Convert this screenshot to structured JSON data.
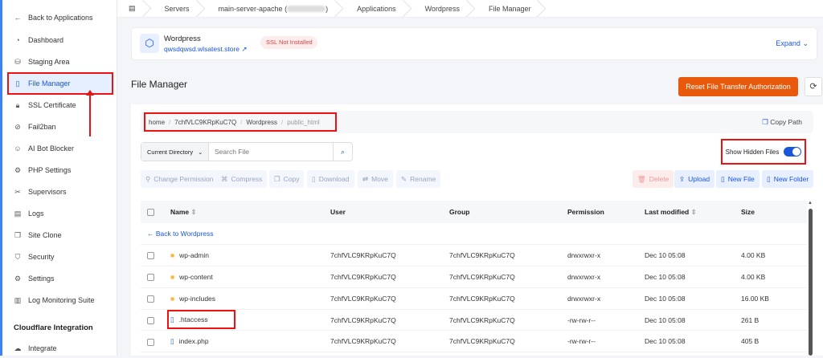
{
  "sidebar": {
    "back": "Back to Applications",
    "items": [
      {
        "label": "Dashboard",
        "icon": "gauge-icon"
      },
      {
        "label": "Staging Area",
        "icon": "database-icon"
      },
      {
        "label": "File Manager",
        "icon": "file-icon"
      },
      {
        "label": "SSL Certificate",
        "icon": "lock-icon"
      },
      {
        "label": "Fail2ban",
        "icon": "ban-icon"
      },
      {
        "label": "AI Bot Blocker",
        "icon": "robot-icon"
      },
      {
        "label": "PHP Settings",
        "icon": "php-icon"
      },
      {
        "label": "Supervisors",
        "icon": "tools-icon"
      },
      {
        "label": "Logs",
        "icon": "doc-icon"
      },
      {
        "label": "Site Clone",
        "icon": "clone-icon"
      },
      {
        "label": "Security",
        "icon": "shield-icon"
      },
      {
        "label": "Settings",
        "icon": "gear-icon"
      },
      {
        "label": "Log Monitoring Suite",
        "icon": "chart-icon"
      }
    ],
    "section": "Cloudflare Integration",
    "integrate": "Integrate"
  },
  "breadcrumbs": [
    "Servers",
    "main-server-apache (",
    ")",
    "Applications",
    "Wordpress",
    "File Manager"
  ],
  "app": {
    "name": "Wordpress",
    "link": "qwsdqwsd.wlsatest.store ↗",
    "ssl": "SSL Not Installed",
    "expand": "Expand"
  },
  "page": {
    "title": "File Manager",
    "reset": "Reset File Transfer Authorization"
  },
  "path": [
    "home",
    "7chfVLC9KRpKuC7Q",
    "Wordpress",
    "public_html"
  ],
  "copy_path": "Copy Path",
  "search": {
    "scope": "Current Directory",
    "placeholder": "Search File"
  },
  "show_hidden": "Show Hidden Files",
  "show_hidden_on": true,
  "actions": {
    "change_permission": "Change Permission",
    "compress": "Compress",
    "copy": "Copy",
    "download": "Download",
    "move": "Move",
    "rename": "Rename",
    "delete": "Delete",
    "upload": "Upload",
    "new_file": "New File",
    "new_folder": "New Folder"
  },
  "table": {
    "headers": [
      "Name",
      "User",
      "Group",
      "Permission",
      "Last modified",
      "Size"
    ],
    "back": "Back to Wordpress",
    "rows": [
      {
        "name": "wp-admin",
        "type": "folder",
        "user": "7chfVLC9KRpKuC7Q",
        "group": "7chfVLC9KRpKuC7Q",
        "perm": "drwxrwxr-x",
        "mod": "Dec 10 05:08",
        "size": "4.00 KB"
      },
      {
        "name": "wp-content",
        "type": "folder",
        "user": "7chfVLC9KRpKuC7Q",
        "group": "7chfVLC9KRpKuC7Q",
        "perm": "drwxrwxr-x",
        "mod": "Dec 10 05:08",
        "size": "4.00 KB"
      },
      {
        "name": "wp-includes",
        "type": "folder",
        "user": "7chfVLC9KRpKuC7Q",
        "group": "7chfVLC9KRpKuC7Q",
        "perm": "drwxrwxr-x",
        "mod": "Dec 10 05:08",
        "size": "16.00 KB"
      },
      {
        "name": ".htaccess",
        "type": "file",
        "user": "7chfVLC9KRpKuC7Q",
        "group": "7chfVLC9KRpKuC7Q",
        "perm": "-rw-rw-r--",
        "mod": "Dec 10 05:08",
        "size": "261 B"
      },
      {
        "name": "index.php",
        "type": "file",
        "user": "7chfVLC9KRpKuC7Q",
        "group": "7chfVLC9KRpKuC7Q",
        "perm": "-rw-rw-r--",
        "mod": "Dec 10 05:08",
        "size": "405 B"
      }
    ]
  }
}
